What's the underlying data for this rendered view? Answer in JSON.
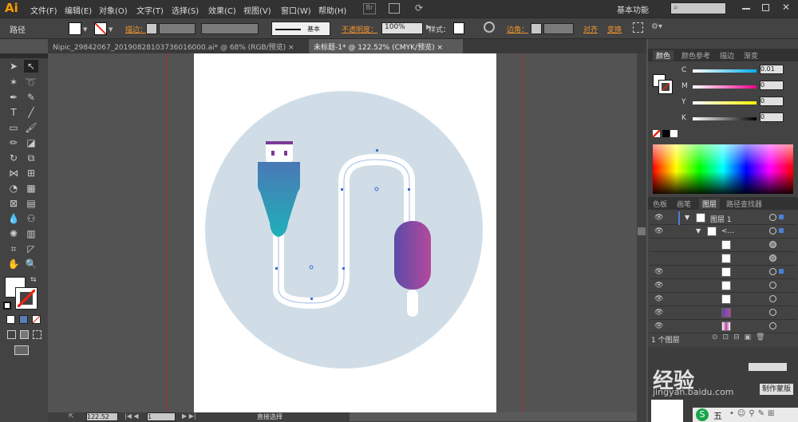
{
  "app": {
    "logo": "Ai",
    "workspace": "基本功能",
    "search_placeholder": ""
  },
  "menu": [
    "文件(F)",
    "编辑(E)",
    "对象(O)",
    "文字(T)",
    "选择(S)",
    "效果(C)",
    "视图(V)",
    "窗口(W)",
    "帮助(H)"
  ],
  "control": {
    "selection_label": "路径",
    "stroke_label": "描边：",
    "line_style": "基本",
    "opacity_label": "不透明度：",
    "opacity_value": "100%",
    "style_label": "样式：",
    "corner_label": "边角：",
    "align_label": "对齐",
    "transform_label": "变换"
  },
  "tabs": [
    {
      "label": "Nipic_29842067_20190828103736016000.ai* @ 68% (RGB/预览)",
      "close": "×"
    },
    {
      "label": "未标题-1* @ 122.52% (CMYK/预览)",
      "close": "×"
    }
  ],
  "status": {
    "zoom": "122.52",
    "page": "1",
    "tool_text": "直接选择"
  },
  "color_panel": {
    "tabs": [
      "颜色",
      "颜色参考",
      "描边",
      "渐变"
    ],
    "channels": [
      {
        "label": "C",
        "value": "0.01",
        "color": "#00aeef"
      },
      {
        "label": "M",
        "value": "0",
        "color": "#ec008c"
      },
      {
        "label": "Y",
        "value": "0",
        "color": "#fff200"
      },
      {
        "label": "K",
        "value": "0",
        "color": "#000000"
      }
    ]
  },
  "layers_panel": {
    "tabs": [
      "色板",
      "画笔",
      "图层",
      "路径查找器"
    ],
    "layer_name": "图层 1",
    "group_name": "<...",
    "footer": "1 个图层"
  },
  "watermark": {
    "text": "经验",
    "sub": "jingyan.baidu.com"
  },
  "mask_button": "制作蒙版",
  "taskbar_text": "五"
}
